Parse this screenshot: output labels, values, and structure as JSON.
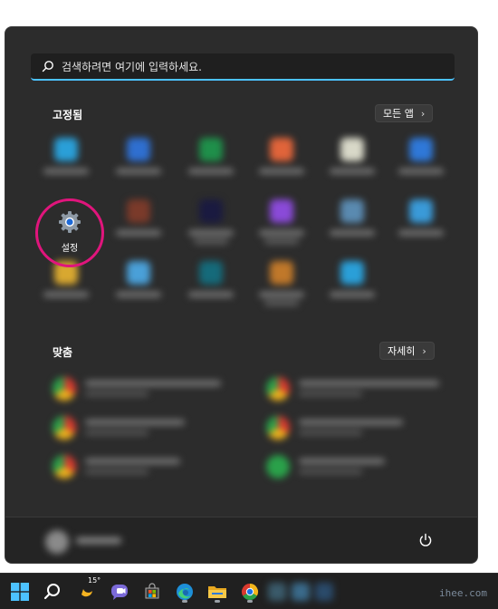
{
  "search": {
    "placeholder": "검색하려면 여기에 입력하세요."
  },
  "pinned": {
    "title": "고정됨",
    "all_apps_label": "모든 앱",
    "settings_label": "설정",
    "app_colors": [
      "#2a9fd8",
      "#2f6fd0",
      "#1f8f4a",
      "#e0643a",
      "#d8d8c8",
      "#2f78d8",
      "#7a3a2a",
      "#1a1a40",
      "#8a4ad8",
      "#5a8ab0",
      "#3a9ad8",
      "#d8a830",
      "#4aa0d8",
      "#156a7a",
      "#c0782a"
    ]
  },
  "recommended": {
    "title": "맞춤",
    "more_label": "자세히"
  },
  "taskbar": {
    "weather_temp": "15°"
  },
  "watermark": "ihee.com",
  "colors": {
    "accent": "#4cc2ff",
    "highlight_circle": "#e0157c",
    "panel": "#2c2c2c"
  }
}
